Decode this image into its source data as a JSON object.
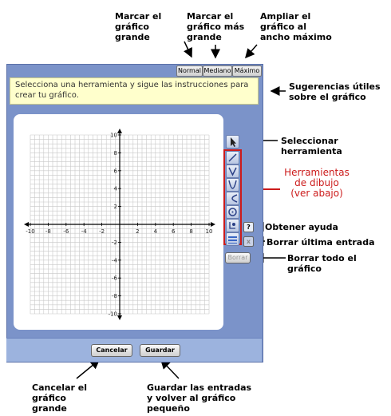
{
  "callouts": {
    "large": "Marcar el\ngráfico\ngrande",
    "medium": "Marcar el\ngráfico más\ngrande",
    "max": "Ampliar el\ngráfico al\nancho máximo",
    "hints": "Sugerencias útiles\nsobre el gráfico",
    "select": "Seleccionar herramienta",
    "drawing": "Herramientas\nde dibujo\n(ver abajo)",
    "help": "Obtener ayuda",
    "undo": "Borrar última entrada",
    "clear": "Borrar todo el gráfico",
    "cancel": "Cancelar el\ngráfico\ngrande",
    "save": "Guardar las entradas\ny volver al gráfico\npequeño"
  },
  "zoom": {
    "normal": "Normal",
    "medium": "Mediano",
    "max": "Máximo"
  },
  "hint_text": "Selecciona una herramienta y sigue las instrucciones para crear tu gráfico.",
  "help_label": "?",
  "undo_label": "x",
  "clear_button": "Borrar",
  "cancel_button": "Cancelar",
  "save_button": "Guardar",
  "graph": {
    "x_ticks": [
      "-10",
      "-8",
      "-6",
      "-4",
      "-2",
      "2",
      "4",
      "6",
      "8",
      "10"
    ],
    "y_ticks": [
      "10",
      "8",
      "6",
      "4",
      "2",
      "-2",
      "-4",
      "-6",
      "-8",
      "-10"
    ]
  },
  "tools": [
    {
      "icon": "pointer-icon"
    },
    {
      "icon": "line-tool-icon"
    },
    {
      "icon": "absolute-value-tool-icon"
    },
    {
      "icon": "parabola-tool-icon"
    },
    {
      "icon": "curve-tool-icon"
    },
    {
      "icon": "circle-tool-icon"
    },
    {
      "icon": "point-tool-icon"
    },
    {
      "icon": "shading-tool-icon"
    }
  ],
  "colors": {
    "panel": "#7b93c9",
    "highlight": "#cc1b1b",
    "hint_bg": "#ffffcc"
  }
}
